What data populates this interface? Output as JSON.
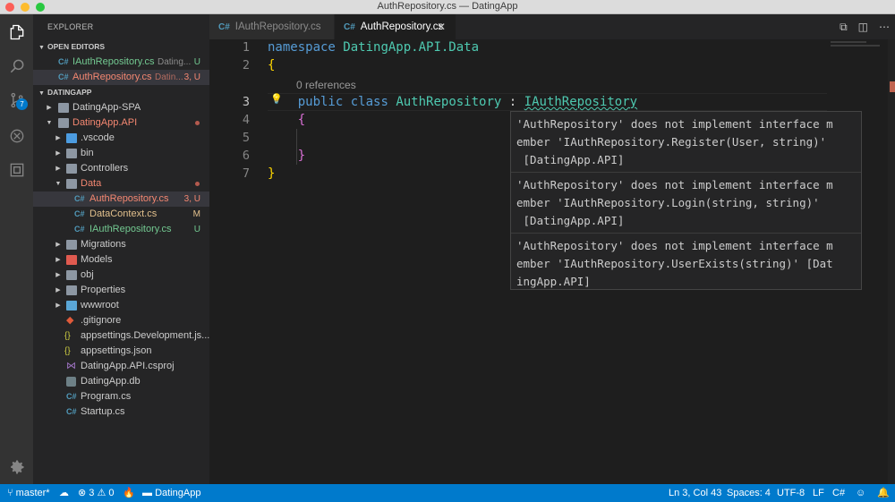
{
  "window": {
    "title": "AuthRepository.cs — DatingApp"
  },
  "activity_bar": {
    "icons": [
      "files-icon",
      "search-icon",
      "source-control-icon",
      "debug-icon",
      "extensions-icon",
      "gear-icon"
    ],
    "source_control_badge": "7"
  },
  "sidebar": {
    "header": "EXPLORER",
    "open_editors": {
      "title": "OPEN EDITORS",
      "items": [
        {
          "name": "IAuthRepository.cs",
          "description": "Dating...",
          "status": "U"
        },
        {
          "name": "AuthRepository.cs",
          "description": "Datin...",
          "status": "3, U"
        }
      ]
    },
    "project": {
      "title": "DATINGAPP",
      "items": [
        {
          "label": "DatingApp-SPA",
          "status": ""
        },
        {
          "label": "DatingApp.API",
          "status": ""
        },
        {
          "label": ".vscode",
          "status": ""
        },
        {
          "label": "bin",
          "status": ""
        },
        {
          "label": "Controllers",
          "status": ""
        },
        {
          "label": "Data",
          "status": ""
        },
        {
          "label": "AuthRepository.cs",
          "status": "3, U"
        },
        {
          "label": "DataContext.cs",
          "status": "M"
        },
        {
          "label": "IAuthRepository.cs",
          "status": "U"
        },
        {
          "label": "Migrations",
          "status": ""
        },
        {
          "label": "Models",
          "status": ""
        },
        {
          "label": "obj",
          "status": ""
        },
        {
          "label": "Properties",
          "status": ""
        },
        {
          "label": "wwwroot",
          "status": ""
        },
        {
          "label": ".gitignore",
          "status": ""
        },
        {
          "label": "appsettings.Development.js...",
          "status": ""
        },
        {
          "label": "appsettings.json",
          "status": ""
        },
        {
          "label": "DatingApp.API.csproj",
          "status": ""
        },
        {
          "label": "DatingApp.db",
          "status": ""
        },
        {
          "label": "Program.cs",
          "status": ""
        },
        {
          "label": "Startup.cs",
          "status": ""
        }
      ]
    }
  },
  "tabs": [
    {
      "label": "IAuthRepository.cs",
      "active": false
    },
    {
      "label": "AuthRepository.cs",
      "active": true
    }
  ],
  "editor": {
    "line_numbers": [
      "1",
      "2",
      "3",
      "4",
      "5",
      "6",
      "7"
    ],
    "codelens": "0 references",
    "code": {
      "line1_kw": "namespace",
      "line1_ns": "DatingApp.API.Data",
      "line2": "{",
      "line3_kw1": "public",
      "line3_kw2": "class",
      "line3_type": "AuthRepository",
      "line3_colon": ":",
      "line3_base": "IAuthRepository",
      "line4": "{",
      "line6": "}",
      "line7": "}"
    },
    "hover_messages": [
      "'AuthRepository' does not implement interface m\nember 'IAuthRepository.Register(User, string)'\n [DatingApp.API]",
      "'AuthRepository' does not implement interface m\nember 'IAuthRepository.Login(string, string)'\n [DatingApp.API]",
      "'AuthRepository' does not implement interface m\nember 'IAuthRepository.UserExists(string)' [Dat\ningApp.API]"
    ]
  },
  "statusbar": {
    "branch": "master*",
    "errors": "3",
    "warnings": "0",
    "project": "DatingApp",
    "position": "Ln 3, Col 43",
    "spaces": "Spaces: 4",
    "encoding": "UTF-8",
    "eol": "LF",
    "language": "C#"
  },
  "colors": {
    "accent": "#007acc",
    "error_file": "#f48771",
    "untracked": "#73c991",
    "modified": "#e2c08d"
  }
}
